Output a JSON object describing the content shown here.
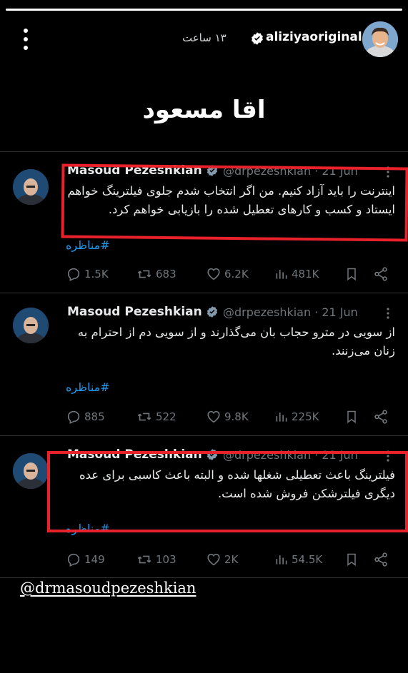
{
  "story": {
    "username": "aliziyaoriginal",
    "time": "۱۳ ساعت",
    "headline": "اقا مسعود",
    "mention": "@drmasoudpezeshkian",
    "progress": 1.0
  },
  "icons": {
    "menu": "vertical-ellipsis-icon",
    "verified": "verified-badge-icon",
    "reply": "reply-icon",
    "retweet": "retweet-icon",
    "like": "heart-icon",
    "views": "views-icon",
    "bookmark": "bookmark-icon",
    "share": "share-icon"
  },
  "colors": {
    "highlight_box": "#e8212a",
    "link": "#1d9bf0",
    "verified": "#829aab"
  },
  "tweets": [
    {
      "name": "Masoud Pezeshkian",
      "handle": "@drpezeshkian · 21 Jun",
      "text": "اینترنت را باید آزاد کنیم. من اگر انتخاب شدم جلوی فیلترینگ خواهم ایستاد و کسب و کارهای تعطیل شده را بازیابی خواهم کرد.",
      "hashtag": "#مناظره",
      "replies": "1.5K",
      "retweets": "683",
      "likes": "6.2K",
      "views": "481K"
    },
    {
      "name": "Masoud Pezeshkian",
      "handle": "@drpezeshkian · 21 Jun",
      "text": "از سویی در مترو حجاب بان می‌گذارند و از سویی دم از احترام به زنان می‌زنند.",
      "hashtag": "#مناظره",
      "replies": "885",
      "retweets": "522",
      "likes": "9.8K",
      "views": "225K"
    },
    {
      "name": "Masoud Pezeshkian",
      "handle": "@drpezeshkian · 21 Jun",
      "text": "فیلترینگ باعث تعطیلی شغلها شده و البته باعث کاسبی برای عده دیگری فیلترشکن فروش شده است.",
      "hashtag": "#مناظره",
      "replies": "149",
      "retweets": "103",
      "likes": "2K",
      "views": "54.5K"
    }
  ]
}
